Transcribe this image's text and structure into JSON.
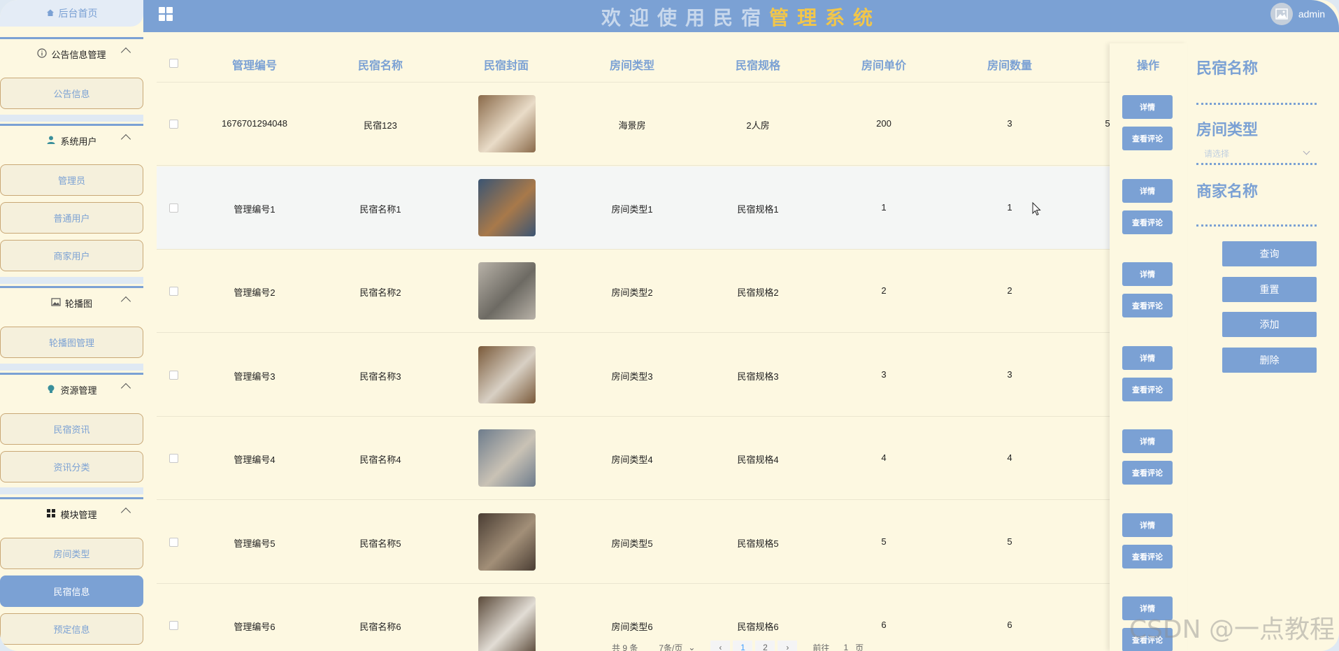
{
  "header": {
    "title_part1": "欢迎使用民宿",
    "title_part2": "管理系统",
    "username": "admin",
    "brand_color": "#7ba1d4",
    "accent_color": "#f2c64a"
  },
  "sidebar": {
    "home": "后台首页",
    "groups": [
      {
        "label": "公告信息管理",
        "icon": "info-icon",
        "items": [
          "公告信息"
        ]
      },
      {
        "label": "系统用户",
        "icon": "user-icon",
        "items": [
          "管理员",
          "普通用户",
          "商家用户"
        ]
      },
      {
        "label": "轮播图",
        "icon": "picture-icon",
        "items": [
          "轮播图管理"
        ]
      },
      {
        "label": "资源管理",
        "icon": "bulb-icon",
        "items": [
          "民宿资讯",
          "资讯分类"
        ]
      },
      {
        "label": "模块管理",
        "icon": "grid-icon",
        "items": [
          "房间类型",
          "民宿信息",
          "预定信息"
        ]
      }
    ],
    "active_item": "民宿信息"
  },
  "table": {
    "headers": [
      "管理编号",
      "民宿名称",
      "民宿封面",
      "房间类型",
      "民宿规格",
      "房间单价",
      "房间数量",
      "操作"
    ],
    "rows": [
      {
        "id": "1676701294048",
        "name": "民宿123",
        "type": "海景房",
        "spec": "2人房",
        "price": "200",
        "count": "3",
        "extra": "5"
      },
      {
        "id": "管理编号1",
        "name": "民宿名称1",
        "type": "房间类型1",
        "spec": "民宿规格1",
        "price": "1",
        "count": "1",
        "extra": ""
      },
      {
        "id": "管理编号2",
        "name": "民宿名称2",
        "type": "房间类型2",
        "spec": "民宿规格2",
        "price": "2",
        "count": "2",
        "extra": ""
      },
      {
        "id": "管理编号3",
        "name": "民宿名称3",
        "type": "房间类型3",
        "spec": "民宿规格3",
        "price": "3",
        "count": "3",
        "extra": ""
      },
      {
        "id": "管理编号4",
        "name": "民宿名称4",
        "type": "房间类型4",
        "spec": "民宿规格4",
        "price": "4",
        "count": "4",
        "extra": ""
      },
      {
        "id": "管理编号5",
        "name": "民宿名称5",
        "type": "房间类型5",
        "spec": "民宿规格5",
        "price": "5",
        "count": "5",
        "extra": ""
      },
      {
        "id": "管理编号6",
        "name": "民宿名称6",
        "type": "房间类型6",
        "spec": "民宿规格6",
        "price": "6",
        "count": "6",
        "extra": ""
      }
    ],
    "btn_detail": "详情",
    "btn_comments": "查看评论"
  },
  "pagination": {
    "total": "共 9 条",
    "page_size": "7条/页",
    "pages": [
      "1",
      "2"
    ],
    "goto_prefix": "前往",
    "goto_value": "1",
    "goto_suffix": "页"
  },
  "search_panel": {
    "label_name": "民宿名称",
    "label_type": "房间类型",
    "type_placeholder": "请选择",
    "label_merchant": "商家名称",
    "btn_query": "查询",
    "btn_reset": "重置",
    "btn_add": "添加",
    "btn_delete": "删除"
  },
  "watermark": "CSDN @一点教程"
}
